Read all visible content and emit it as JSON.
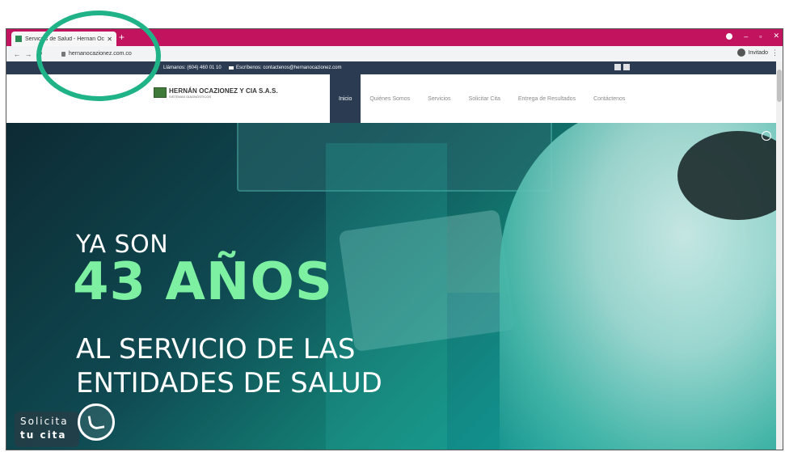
{
  "browser": {
    "tab_title": "Servicios de Salud - Hernan Oca...",
    "new_tab": "+",
    "url": "hernanocazionez.com.co",
    "profile_label": "Invitado"
  },
  "topbar": {
    "phone": "Llámanos: (604) 460 01 10",
    "email": "Escríbenos: contactenos@hernanocazionez.com"
  },
  "header": {
    "logo_name": "HERNÁN OCAZIONEZ Y CIA S.A.S.",
    "logo_sub": "SISTEMAS DIAGNÓSTICOS",
    "nav": [
      "Inicio",
      "Quiénes Somos",
      "Servicios",
      "Solicitar Cita",
      "Entrega de Resultados",
      "Contáctenos"
    ]
  },
  "hero": {
    "line1": "YA SON",
    "line2": "43 AÑOS",
    "line3": "AL SERVICIO DE LAS",
    "line4": "ENTIDADES DE SALUD"
  },
  "whatsapp": {
    "line1": "Solicita",
    "line2": "tu cita"
  },
  "colors": {
    "tab_bar": "#c2135f",
    "nav_active": "#2b3b52",
    "hero_accent": "#7ef0a2",
    "annotation": "#1fb387"
  }
}
